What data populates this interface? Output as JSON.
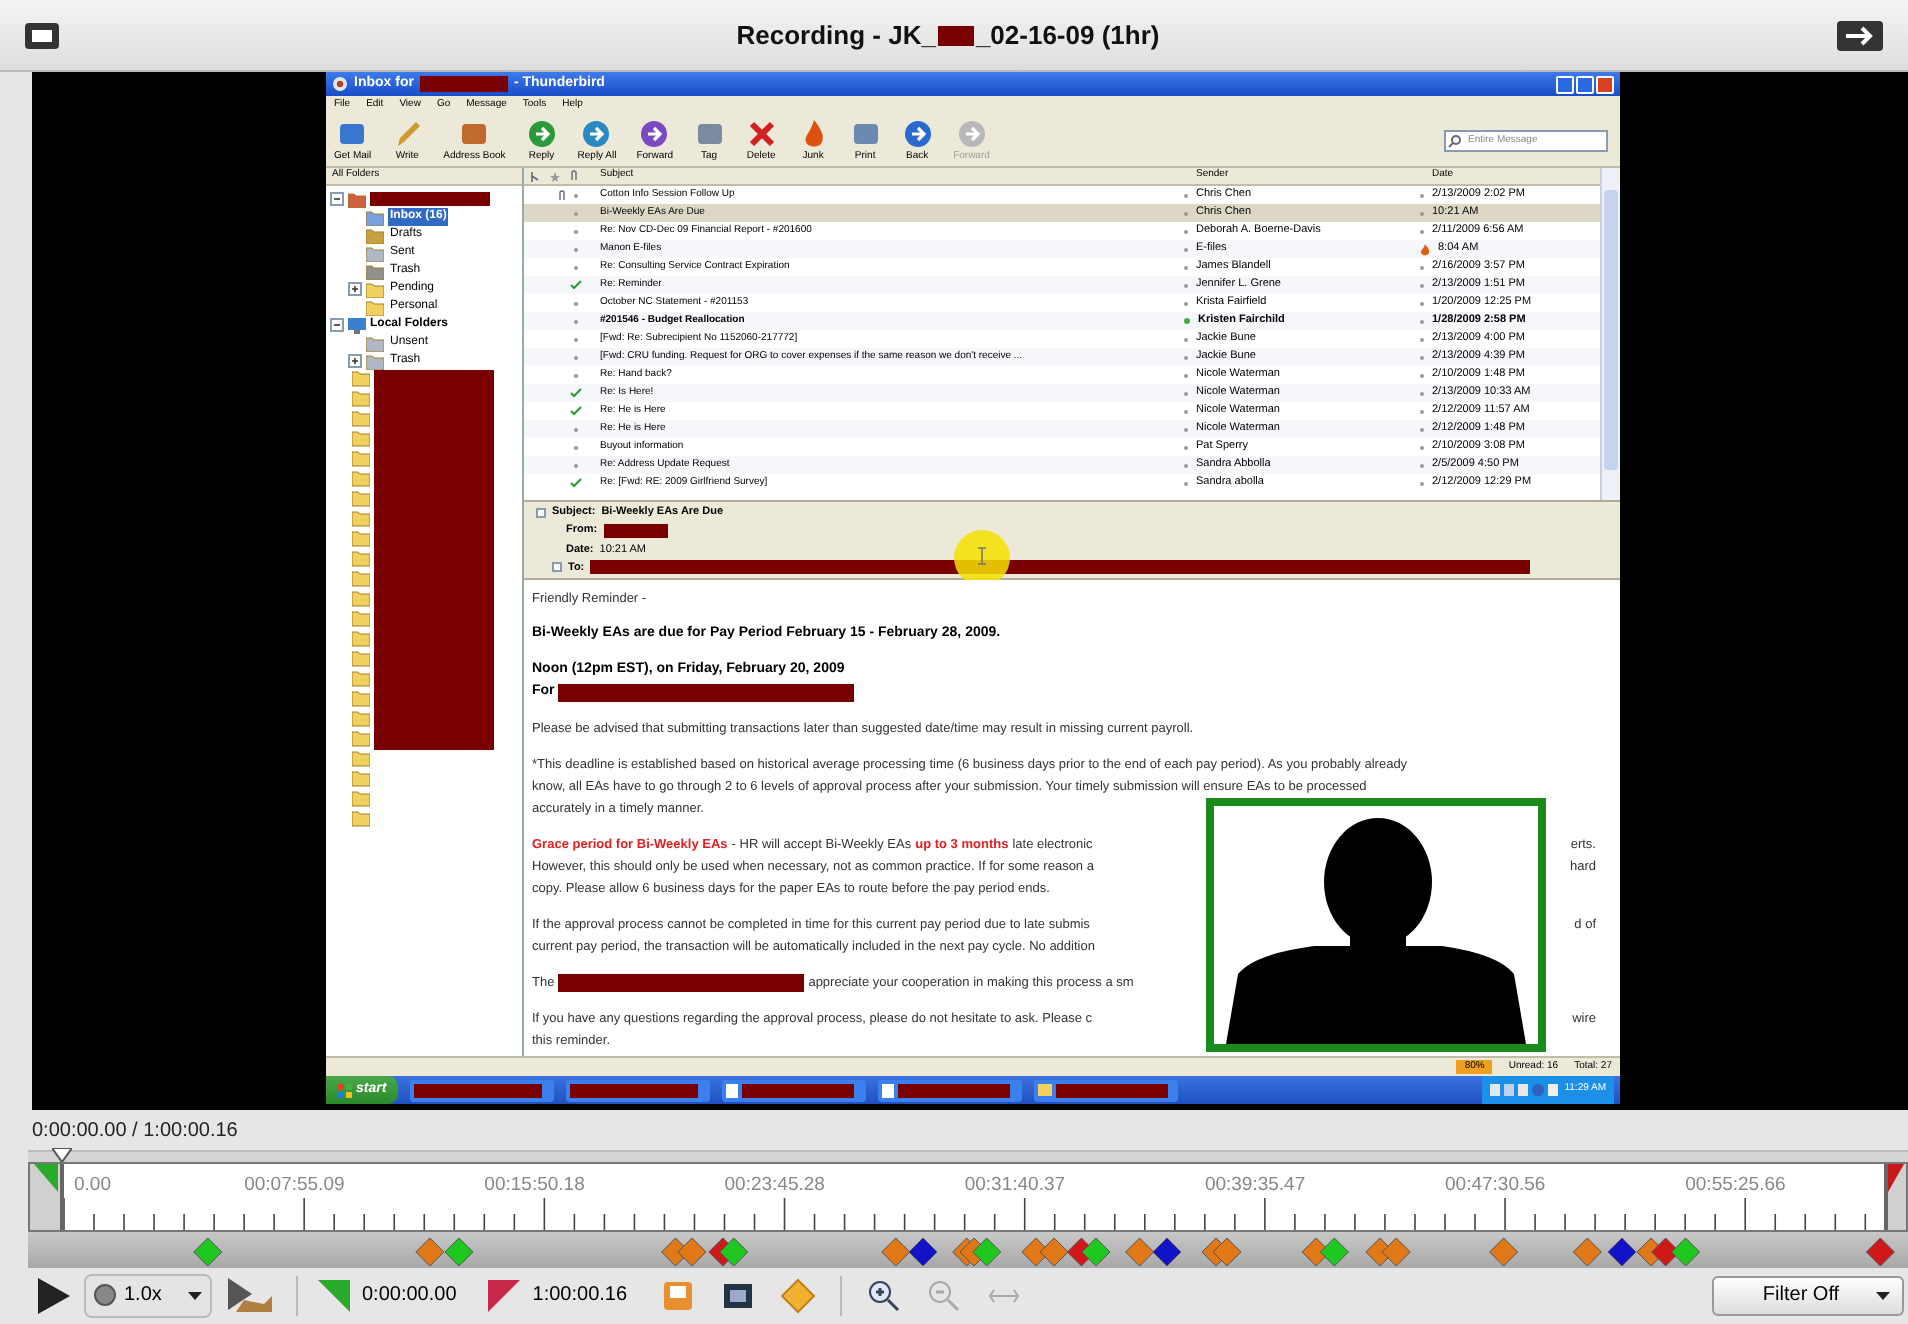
{
  "window": {
    "title_start": "Recording - JK_",
    "title_end": "_02-16-09 (1hr)"
  },
  "mail": {
    "title_end": "- Thunderbird",
    "title_start": "Inbox for",
    "menu": [
      "File",
      "Edit",
      "View",
      "Go",
      "Message",
      "Tools",
      "Help"
    ],
    "toolbar": [
      {
        "label": "Get Mail",
        "disabled": false
      },
      {
        "label": "Write",
        "disabled": false
      },
      {
        "label": "Address Book",
        "disabled": false
      },
      {
        "label": "Reply",
        "disabled": false
      },
      {
        "label": "Reply All",
        "disabled": false
      },
      {
        "label": "Forward",
        "disabled": false
      },
      {
        "label": "Tag",
        "disabled": false
      },
      {
        "label": "Delete",
        "disabled": false
      },
      {
        "label": "Junk",
        "disabled": false
      },
      {
        "label": "Print",
        "disabled": false
      },
      {
        "label": "Back",
        "disabled": false
      },
      {
        "label": "Forward",
        "disabled": true
      }
    ],
    "search": {
      "placeholder": "Entire Message"
    },
    "folder_header": "All Folders",
    "folders": [
      {
        "kind": "account",
        "expanded": true,
        "children": [
          {
            "label": "Inbox (16)",
            "selected": true,
            "kind": "leaf"
          },
          {
            "label": "Drafts",
            "selected": false,
            "kind": "leaf"
          },
          {
            "label": "Sent",
            "selected": false,
            "kind": "leaf"
          },
          {
            "label": "Trash",
            "selected": false,
            "kind": "leaf"
          },
          {
            "label": "Pending",
            "selected": false,
            "kind": "branch",
            "expanded": false
          },
          {
            "label": "Personal",
            "selected": false,
            "kind": "leaf"
          }
        ]
      },
      {
        "kind": "local",
        "label": "Local Folders",
        "expanded": true,
        "children": [
          {
            "label": "Unsent",
            "selected": false,
            "kind": "leaf"
          },
          {
            "label": "Trash",
            "selected": false,
            "kind": "branch",
            "expanded": false
          }
        ]
      }
    ],
    "columns": {
      "subject": "Subject",
      "sender": "Sender",
      "date": "Date"
    },
    "messages": [
      {
        "subject": "Cotton Info Session Follow Up",
        "sender": "Chris Chen",
        "date": "2/13/2009 2:02 PM",
        "selected": false,
        "unread": false,
        "replied": false,
        "attachment": true,
        "junk": false
      },
      {
        "subject": "Bi-Weekly EAs Are Due",
        "sender": "Chris Chen",
        "date": "10:21 AM",
        "selected": true,
        "unread": false,
        "replied": false,
        "attachment": false,
        "junk": false
      },
      {
        "subject": "Re: Nov CD-Dec 09 Financial Report - #201600",
        "sender": "Deborah A. Boerne-Davis",
        "date": "2/11/2009 6:56 AM",
        "selected": false,
        "unread": false,
        "replied": false,
        "attachment": false,
        "junk": false
      },
      {
        "subject": "Manon E-files",
        "sender": "E-files",
        "date": "8:04 AM",
        "selected": false,
        "unread": false,
        "replied": false,
        "attachment": false,
        "junk": true
      },
      {
        "subject": "Re: Consulting Service Contract Expiration",
        "sender": "James Blandell",
        "date": "2/16/2009 3:57 PM",
        "selected": false,
        "unread": false,
        "replied": false,
        "attachment": false,
        "junk": false
      },
      {
        "subject": "Re: Reminder",
        "sender": "Jennifer L. Grene",
        "date": "2/13/2009 1:51 PM",
        "selected": false,
        "unread": false,
        "replied": true,
        "attachment": false,
        "junk": false
      },
      {
        "subject": "October NC Statement - #201153",
        "sender": "Krista Fairfield",
        "date": "1/20/2009 12:25 PM",
        "selected": false,
        "unread": false,
        "replied": false,
        "attachment": false,
        "junk": false
      },
      {
        "subject": "#201546 - Budget Reallocation",
        "sender": "Kristen Fairchild",
        "date": "1/28/2009 2:58 PM",
        "selected": false,
        "unread": true,
        "replied": false,
        "attachment": false,
        "junk": false
      },
      {
        "subject": "[Fwd: Re: Subrecipient No 1152060-217772]",
        "sender": "Jackie Bune",
        "date": "2/13/2009 4:00 PM",
        "selected": false,
        "unread": false,
        "replied": false,
        "attachment": false,
        "junk": false
      },
      {
        "subject": "[Fwd: CRU funding.  Request for ORG to cover expenses if the same reason we don't receive ...",
        "sender": "Jackie Bune",
        "date": "2/13/2009 4:39 PM",
        "selected": false,
        "unread": false,
        "replied": false,
        "attachment": false,
        "junk": false
      },
      {
        "subject": "Re: Hand back?",
        "sender": "Nicole Waterman",
        "date": "2/10/2009 1:48 PM",
        "selected": false,
        "unread": false,
        "replied": false,
        "attachment": false,
        "junk": false
      },
      {
        "subject": "Re: Is Here!",
        "sender": "Nicole Waterman",
        "date": "2/13/2009 10:33 AM",
        "selected": false,
        "unread": false,
        "replied": true,
        "attachment": false,
        "junk": false
      },
      {
        "subject": "Re: He is Here",
        "sender": "Nicole Waterman",
        "date": "2/12/2009 11:57 AM",
        "selected": false,
        "unread": false,
        "replied": true,
        "attachment": false,
        "junk": false
      },
      {
        "subject": "Re: He is Here",
        "sender": "Nicole Waterman",
        "date": "2/12/2009 1:48 PM",
        "selected": false,
        "unread": false,
        "replied": false,
        "attachment": false,
        "junk": false
      },
      {
        "subject": "Buyout information",
        "sender": "Pat Sperry",
        "date": "2/10/2009 3:08 PM",
        "selected": false,
        "unread": false,
        "replied": false,
        "attachment": false,
        "junk": false
      },
      {
        "subject": "Re: Address Update Request",
        "sender": "Sandra Abbolla",
        "date": "2/5/2009 4:50 PM",
        "selected": false,
        "unread": false,
        "replied": false,
        "attachment": false,
        "junk": false
      },
      {
        "subject": "Re: [Fwd: RE: 2009 Girlfriend Survey]",
        "sender": "Sandra abolla",
        "date": "2/12/2009 12:29 PM",
        "selected": false,
        "unread": false,
        "replied": true,
        "attachment": false,
        "junk": false
      }
    ],
    "header": {
      "subject_label": "Subject:",
      "subject": "Bi-Weekly EAs Are Due",
      "from_label": "From:",
      "date_label": "Date:",
      "date": "10:21 AM",
      "to_label": "To:"
    },
    "body": [
      {
        "lines": [
          {
            "segments": [
              {
                "kind": "plain",
                "text": "Friendly Reminder -"
              }
            ]
          }
        ]
      },
      {
        "lines": [
          {
            "segments": [
              {
                "kind": "bold",
                "text": "Bi-Weekly EAs are due for Pay Period February 15 - February 28, 2009."
              }
            ]
          }
        ]
      },
      {
        "lines": [
          {
            "segments": [
              {
                "kind": "bold",
                "text": "Noon (12pm EST), on Friday, February 20, 2009"
              }
            ]
          },
          {
            "segments": [
              {
                "kind": "bold",
                "text": "For"
              },
              {
                "kind": "long_redaction"
              }
            ]
          }
        ]
      },
      {
        "lines": [
          {
            "segments": [
              {
                "kind": "plain",
                "text": "Please be advised that submitting transactions later than suggested date/time may result in missing current payroll."
              }
            ]
          }
        ]
      },
      {
        "lines": [
          {
            "segments": [
              {
                "kind": "plain",
                "text": "*This deadline is established based on historical average processing time (6 business days prior to the end of each pay period). As you probably already"
              }
            ]
          },
          {
            "segments": [
              {
                "kind": "plain",
                "text": "know, all EAs have to go through 2 to 6 levels of approval process after your submission. Your timely submission will ensure EAs to be processed"
              }
            ]
          },
          {
            "segments": [
              {
                "kind": "plain",
                "text": "accurately in a timely manner."
              }
            ]
          }
        ]
      },
      {
        "lines": [
          {
            "segments": [
              {
                "kind": "red",
                "text": "Grace period for Bi-Weekly EAs"
              },
              {
                "kind": "plain",
                "text": "- HR will accept Bi-Weekly EAs"
              },
              {
                "kind": "red",
                "text": "up to 3 months"
              },
              {
                "kind": "plain",
                "text": "late electronic"
              }
            ],
            "right": "erts."
          },
          {
            "segments": [
              {
                "kind": "plain",
                "text": "However, this should only be used when necessary, not as common practice. If for some reason a"
              }
            ],
            "right": "hard"
          },
          {
            "segments": [
              {
                "kind": "plain",
                "text": "copy. Please allow 6 business days for the paper EAs to route before the pay period ends."
              }
            ]
          }
        ]
      },
      {
        "lines": [
          {
            "segments": [
              {
                "kind": "plain",
                "text": "If the approval process cannot be completed in time for this current pay period due to late submis"
              }
            ],
            "right": "d of"
          },
          {
            "segments": [
              {
                "kind": "plain",
                "text": "current pay period, the transaction will be automatically included in the next pay cycle. No addition"
              }
            ]
          }
        ]
      },
      {
        "lines": [
          {
            "segments": [
              {
                "kind": "plain",
                "text": "The"
              },
              {
                "kind": "short_redaction"
              },
              {
                "kind": "plain",
                "text": "appreciate your cooperation in making this process a sm"
              }
            ]
          }
        ]
      },
      {
        "lines": [
          {
            "segments": [
              {
                "kind": "plain",
                "text": "If you have any questions regarding the approval process, please do not hesitate to ask. Please c"
              }
            ],
            "right": "wire"
          },
          {
            "segments": [
              {
                "kind": "plain",
                "text": "this reminder."
              }
            ]
          }
        ]
      }
    ],
    "status": {
      "progress": "80%",
      "unread": "Unread: 16",
      "total": "Total: 27"
    },
    "taskbar": {
      "start": "start",
      "buttons": [
        {
          "kind": "plain"
        },
        {
          "kind": "plain"
        },
        {
          "kind": "doc"
        },
        {
          "kind": "doc"
        },
        {
          "kind": "folder"
        }
      ],
      "clock": "11:29 AM"
    }
  },
  "player": {
    "position": "0:00:00.00 / 1:00:00.16",
    "ruler_labels": [
      "0.00",
      "00:07:55.09",
      "00:15:50.18",
      "00:23:45.28",
      "00:31:40.37",
      "00:39:35.47",
      "00:47:30.56",
      "00:55:25.66"
    ],
    "markers": [
      {
        "level": 0.079,
        "color": "#1ec81e"
      },
      {
        "level": 0.201,
        "color": "#e07818"
      },
      {
        "level": 0.217,
        "color": "#1ec81e"
      },
      {
        "level": 0.336,
        "color": "#e07818"
      },
      {
        "level": 0.345,
        "color": "#e07818"
      },
      {
        "level": 0.362,
        "color": "#d01818"
      },
      {
        "level": 0.368,
        "color": "#1ec81e"
      },
      {
        "level": 0.457,
        "color": "#e07818"
      },
      {
        "level": 0.472,
        "color": "#1212c8"
      },
      {
        "level": 0.496,
        "color": "#e07818"
      },
      {
        "level": 0.5,
        "color": "#e07818"
      },
      {
        "level": 0.507,
        "color": "#1ec81e"
      },
      {
        "level": 0.534,
        "color": "#e07818"
      },
      {
        "level": 0.544,
        "color": "#e07818"
      },
      {
        "level": 0.559,
        "color": "#d01818"
      },
      {
        "level": 0.567,
        "color": "#1ec81e"
      },
      {
        "level": 0.591,
        "color": "#e07818"
      },
      {
        "level": 0.606,
        "color": "#1212c8"
      },
      {
        "level": 0.633,
        "color": "#e07818"
      },
      {
        "level": 0.639,
        "color": "#e07818"
      },
      {
        "level": 0.688,
        "color": "#e07818"
      },
      {
        "level": 0.698,
        "color": "#1ec81e"
      },
      {
        "level": 0.723,
        "color": "#e07818"
      },
      {
        "level": 0.732,
        "color": "#e07818"
      },
      {
        "level": 0.791,
        "color": "#e07818"
      },
      {
        "level": 0.837,
        "color": "#e07818"
      },
      {
        "level": 0.856,
        "color": "#1212c8"
      },
      {
        "level": 0.872,
        "color": "#e07818"
      },
      {
        "level": 0.88,
        "color": "#d01818"
      },
      {
        "level": 0.891,
        "color": "#1ec81e"
      },
      {
        "level": 0.998,
        "color": "#d01818"
      }
    ],
    "speed": "1.0x",
    "start_time": "0:00:00.00",
    "end_time": "1:00:00.16",
    "filter": "Filter Off"
  }
}
